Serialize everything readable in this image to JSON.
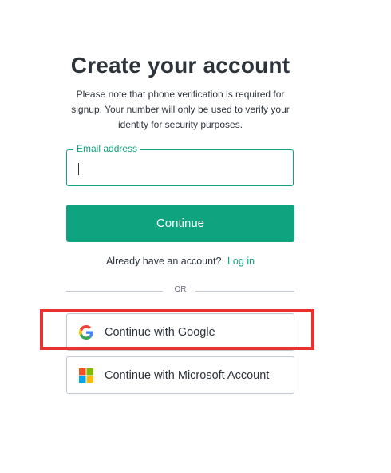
{
  "header": {
    "title": "Create your account",
    "subtitle": "Please note that phone verification is required for signup. Your number will only be used to verify your identity for security purposes."
  },
  "email": {
    "label": "Email address",
    "value": ""
  },
  "continue_button": {
    "label": "Continue"
  },
  "login": {
    "prompt": "Already have an account?",
    "link": "Log in"
  },
  "divider": {
    "text": "OR"
  },
  "social": {
    "google_label": "Continue with Google",
    "microsoft_label": "Continue with Microsoft Account"
  },
  "icons": {
    "google": "google-icon",
    "microsoft": "microsoft-icon"
  },
  "colors": {
    "accent": "#10a37f",
    "highlight": "#e8322f",
    "text": "#2d333a",
    "border": "#c2c8d0"
  }
}
